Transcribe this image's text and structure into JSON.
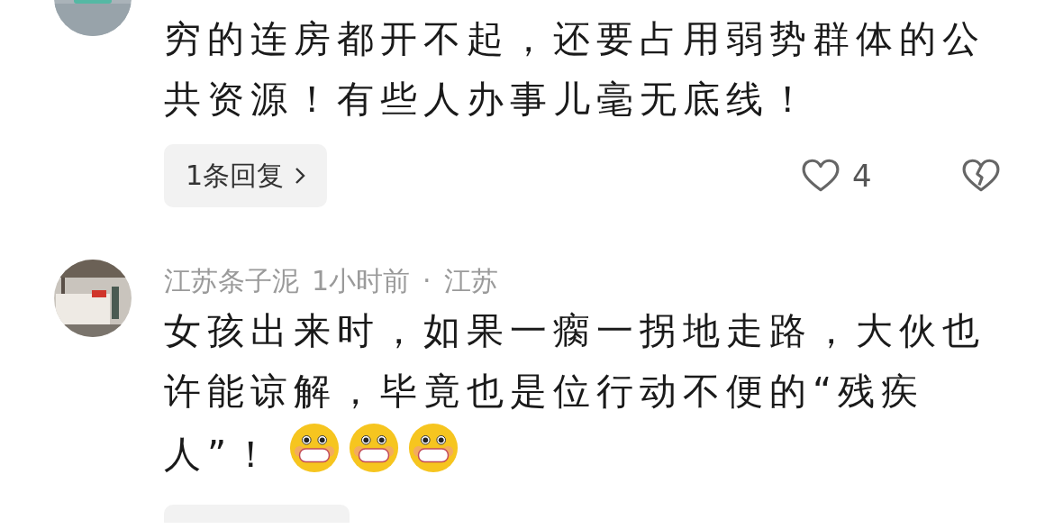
{
  "comments": [
    {
      "body": "穷的连房都开不起，还要占用弱势群体的公共资源！有些人办事儿毫无底线！",
      "reply_button": "1条回复",
      "likes": "4"
    },
    {
      "author": "江苏条子泥",
      "time": "1小时前",
      "separator": "·",
      "location": "江苏",
      "body": "女孩出来时，如果一瘸一拐地走路，大伙也许能谅解，毕竟也是位行动不便的“残疾人”！",
      "emojis": [
        {
          "kind": "grin"
        },
        {
          "kind": "grin"
        },
        {
          "kind": "grin"
        }
      ],
      "reply_pill_cut": true
    }
  ]
}
